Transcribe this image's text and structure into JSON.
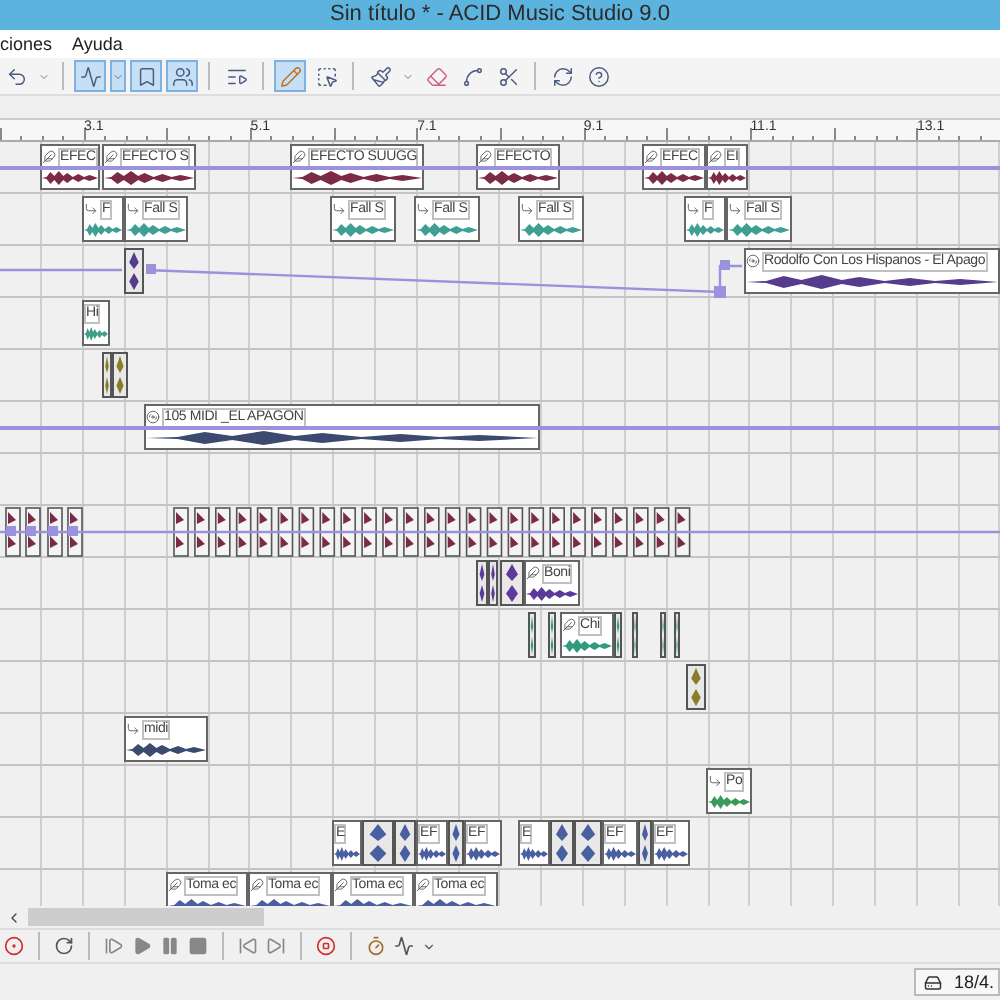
{
  "window": {
    "title": "Sin título * - ACID Music Studio 9.0"
  },
  "menu": [
    "ciones",
    "Ayuda"
  ],
  "toolbar": [
    {
      "kind": "undo",
      "selected": false
    },
    {
      "kind": "caret",
      "selected": false
    },
    {
      "kind": "envelope",
      "selected": true
    },
    {
      "kind": "caret",
      "selected": true
    },
    {
      "kind": "marker",
      "selected": true
    },
    {
      "kind": "group",
      "selected": true
    },
    {
      "kind": "list",
      "selected": false
    },
    {
      "kind": "pencil",
      "selected": true
    },
    {
      "kind": "select",
      "selected": false
    },
    {
      "kind": "paint",
      "selected": false
    },
    {
      "kind": "caret",
      "selected": false
    },
    {
      "kind": "eraser",
      "selected": false
    },
    {
      "kind": "node",
      "selected": false
    },
    {
      "kind": "split",
      "selected": false
    },
    {
      "kind": "loop",
      "selected": false
    },
    {
      "kind": "help",
      "selected": false
    }
  ],
  "ruler": [
    "3.1",
    "5.1",
    "7.1",
    "9.1",
    "11.1",
    "13.1"
  ],
  "tracks": [
    {
      "kind": "clips",
      "color": "#7b2b45",
      "envelope": true,
      "clips": [
        {
          "kind": "oneshot",
          "label": "EFEC"
        },
        {
          "kind": "oneshot",
          "label": "EFECTO S"
        },
        {
          "kind": "oneshot",
          "label": "EFECTO SUUGG"
        },
        {
          "kind": "oneshot",
          "label": "EFECTO"
        },
        {
          "kind": "oneshot",
          "label": "EFEC"
        },
        {
          "kind": "oneshot",
          "label": "EI"
        }
      ]
    },
    {
      "kind": "clips",
      "color": "#3f9f95",
      "envelope": false,
      "clips": [
        {
          "kind": "loop",
          "label": "F"
        },
        {
          "kind": "loop",
          "label": "Fall S"
        },
        {
          "kind": "loop",
          "label": "Fall S"
        },
        {
          "kind": "loop",
          "label": "Fall S"
        },
        {
          "kind": "loop",
          "label": "Fall S"
        },
        {
          "kind": "loop",
          "label": "F"
        },
        {
          "kind": "loop",
          "label": "Fall S"
        }
      ]
    },
    {
      "kind": "clips",
      "color": "#553c8c",
      "envelope": true,
      "clips": [
        {
          "kind": "sliver"
        },
        {
          "kind": "beatmapped",
          "label": "Rodolfo Con Los Hispanos - El Apago"
        }
      ]
    },
    {
      "kind": "clips",
      "color": "#3f9f8a",
      "envelope": false,
      "clips": [
        {
          "kind": "plain",
          "label": "Hi"
        }
      ]
    },
    {
      "kind": "clips",
      "color": "#8a7d2a",
      "envelope": false,
      "clips": [
        {
          "kind": "sliver"
        },
        {
          "kind": "sliver"
        }
      ]
    },
    {
      "kind": "clips",
      "color": "#3b4a6e",
      "envelope": true,
      "clips": [
        {
          "kind": "beatmapped",
          "label": "105 MIDI _EL APAGON"
        }
      ]
    },
    {
      "kind": "empty",
      "envelope": false
    },
    {
      "kind": "pattern",
      "color": "#7b2b45",
      "envelope": true
    },
    {
      "kind": "clips",
      "color": "#5a3a9a",
      "envelope": false,
      "clips": [
        {
          "kind": "sliver"
        },
        {
          "kind": "sliver"
        },
        {
          "kind": "sliver"
        },
        {
          "kind": "oneshot",
          "label": "Boni"
        }
      ]
    },
    {
      "kind": "clips",
      "color": "#2f9b7d",
      "envelope": false,
      "clips": [
        {
          "kind": "sliver"
        },
        {
          "kind": "sliver"
        },
        {
          "kind": "oneshot",
          "label": "Chi"
        },
        {
          "kind": "sliver"
        },
        {
          "kind": "sliver"
        },
        {
          "kind": "sliver"
        },
        {
          "kind": "sliver"
        }
      ]
    },
    {
      "kind": "clips",
      "color": "#8a7d2a",
      "envelope": false,
      "clips": [
        {
          "kind": "sliver"
        }
      ]
    },
    {
      "kind": "clips",
      "color": "#3b4a6e",
      "envelope": false,
      "clips": [
        {
          "kind": "loop",
          "label": "midi"
        }
      ]
    },
    {
      "kind": "clips",
      "color": "#3a9a5a",
      "envelope": false,
      "clips": [
        {
          "kind": "loop",
          "label": "Po"
        }
      ]
    },
    {
      "kind": "clips",
      "color": "#4a5fa0",
      "envelope": false,
      "clips": [
        {
          "kind": "plain",
          "label": "E"
        },
        {
          "kind": "sliver"
        },
        {
          "kind": "sliver"
        },
        {
          "kind": "plain",
          "label": "EF"
        },
        {
          "kind": "sliver"
        },
        {
          "kind": "plain",
          "label": "EF"
        },
        {
          "kind": "plain",
          "label": "E"
        },
        {
          "kind": "sliver"
        },
        {
          "kind": "sliver"
        },
        {
          "kind": "plain",
          "label": "EF"
        },
        {
          "kind": "sliver"
        },
        {
          "kind": "plain",
          "label": "EF"
        }
      ]
    },
    {
      "kind": "clips",
      "color": "#4a5fa0",
      "envelope": false,
      "clips": [
        {
          "kind": "oneshot",
          "label": "Toma ec"
        },
        {
          "kind": "oneshot",
          "label": "Toma ec"
        },
        {
          "kind": "oneshot",
          "label": "Toma ec"
        },
        {
          "kind": "oneshot",
          "label": "Toma ec"
        }
      ]
    }
  ],
  "status_bar": {
    "time": "18/4."
  }
}
